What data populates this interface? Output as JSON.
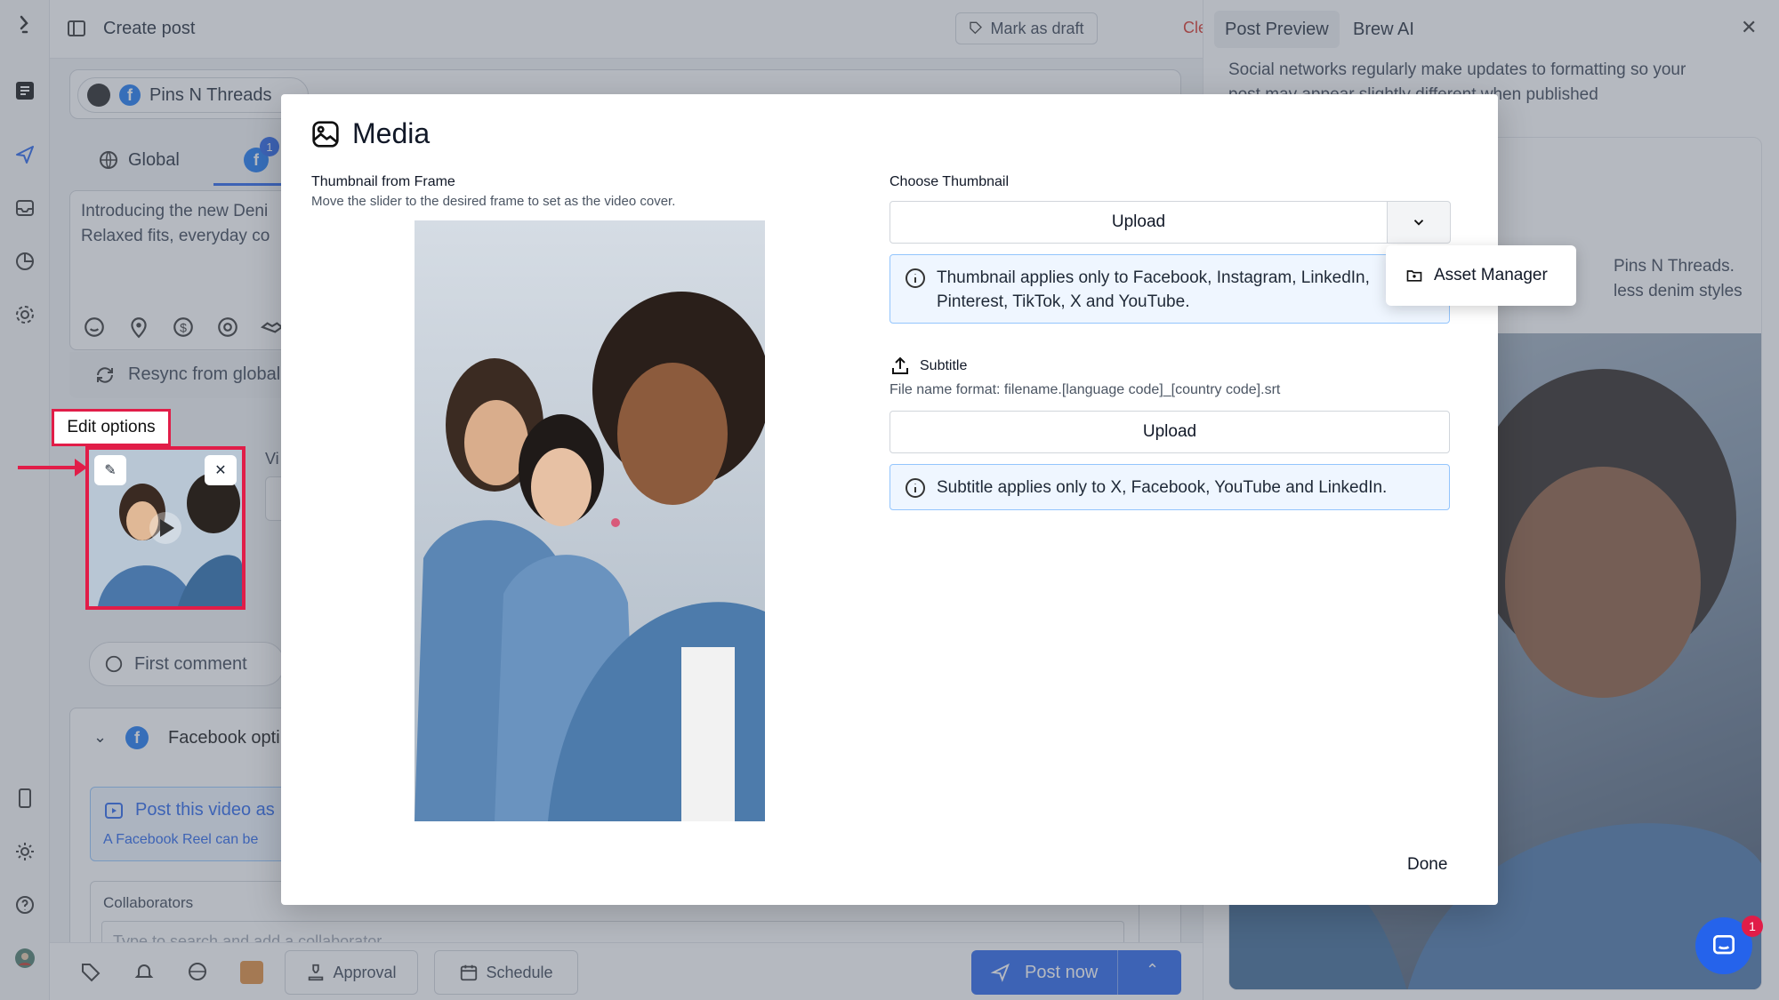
{
  "colors": {
    "accent": "#2563eb",
    "danger": "#e11d48",
    "clear": "#d93025",
    "info_bg": "#eff6ff",
    "info_border": "#93c5fd"
  },
  "header": {
    "title": "Create post",
    "draft_label": "Mark as draft",
    "clear_label": "Clear"
  },
  "account": {
    "name": "Pins N Threads"
  },
  "tabs": {
    "global_label": "Global",
    "facebook_badge": "1"
  },
  "editor": {
    "line1": "Introducing the new Deni",
    "line2": "Relaxed fits, everyday co"
  },
  "resync_label": "Resync from global",
  "annotation": {
    "edit_options": "Edit options"
  },
  "video_label_partial": "Vi",
  "first_comment": "First comment",
  "facebook_options": {
    "title": "Facebook opti",
    "reel_title": "Post this video as",
    "reel_desc": "A Facebook Reel can be",
    "collaborators_label": "Collaborators",
    "collaborators_placeholder": "Type to search and add a collaborator"
  },
  "bottom": {
    "approval": "Approval",
    "schedule": "Schedule",
    "post_now": "Post now"
  },
  "preview": {
    "tab_preview": "Post Preview",
    "tab_brew": "Brew AI",
    "notice_line1": "Social networks regularly make updates to formatting so your",
    "notice_line2": "post may appear slightly different when published",
    "caption_line1": "Pins N Threads.",
    "caption_line2": "less denim styles"
  },
  "modal": {
    "title": "Media",
    "thumb_frame_label": "Thumbnail from Frame",
    "thumb_frame_desc": "Move the slider to the desired frame to set as the video cover.",
    "choose_thumb_label": "Choose Thumbnail",
    "upload_label": "Upload",
    "thumb_info": "Thumbnail applies only to Facebook, Instagram, LinkedIn, Pinterest, TikTok, X and YouTube.",
    "subtitle_label": "Subtitle",
    "subtitle_format": "File name format: filename.[language code]_[country code].srt",
    "subtitle_upload": "Upload",
    "subtitle_info": "Subtitle applies only to X, Facebook, YouTube and LinkedIn.",
    "done": "Done"
  },
  "dropdown": {
    "asset_manager": "Asset Manager"
  },
  "chat_badge": "1"
}
